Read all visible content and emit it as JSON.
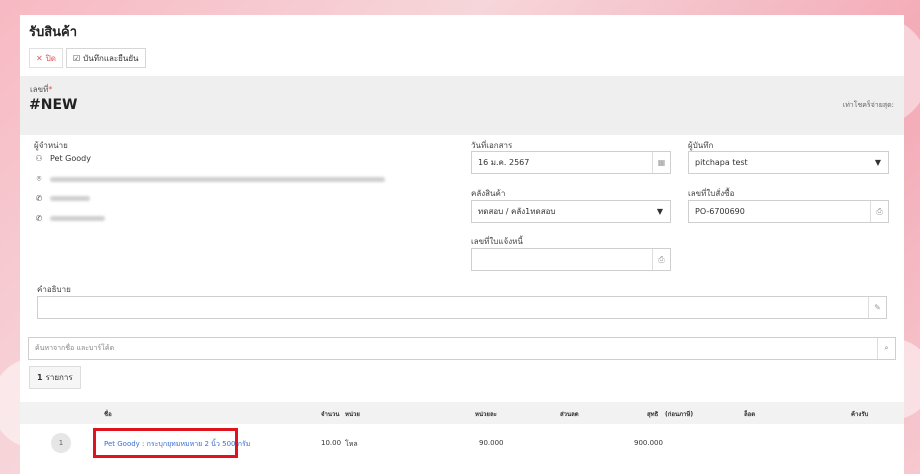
{
  "page": {
    "title": "รับสินค้า",
    "toolbar": {
      "close_label": "ปิด",
      "save_confirm_label": "บันทึกและยืนยัน"
    },
    "doc": {
      "label": "เลขที่",
      "required_mark": "*",
      "number": "#NEW",
      "vat_note": "เท่าโชคร็จ่ายสุด:"
    }
  },
  "supplier": {
    "label": "ผู้จำหน่าย",
    "name": "Pet Goody"
  },
  "form": {
    "doc_date": {
      "label": "วันที่เอกสาร",
      "value": "16 ม.ค. 2567"
    },
    "recorder": {
      "label": "ผู้บันทึก",
      "value": "pitchapa test"
    },
    "warehouse": {
      "label": "คลังสินค้า",
      "value": "ทดสอบ / คลัง1ทดสอบ"
    },
    "po_number": {
      "label": "เลขที่ใบสั่งซื้อ",
      "value": "PO-6700690"
    },
    "invoice_number": {
      "label": "เลขที่ใบแจ้งหนี้",
      "value": ""
    },
    "description": {
      "label": "คำอธิบาย",
      "value": ""
    }
  },
  "search": {
    "placeholder": "ค้นหาจากชื่อ และบาร์โค้ด"
  },
  "items_count": {
    "number": "1",
    "unit": "รายการ"
  },
  "table": {
    "headers": {
      "name": "ชื่อ",
      "qty": "จำนวน",
      "unit": "หน่วย",
      "unit_price": "หน่วยละ",
      "discount": "ส่วนลด",
      "net": "สุทธิ",
      "net_after": "(ก่อนภาษี)",
      "lot": "ล็อต",
      "due": "ค้างรับ"
    },
    "rows": [
      {
        "index": "1",
        "name": "Pet Goody : กระบุกยุทมหมหาย 2 นิ้ว 500 กรัม",
        "qty": "10.00",
        "unit": "โหล",
        "unit_price": "90.000",
        "net": "900.000"
      }
    ]
  },
  "colors": {
    "close": "#e05555",
    "link": "#3b6fd1",
    "highlight": "#e0141e"
  },
  "icons": [
    "close-icon",
    "checkbox-icon",
    "user-icon",
    "map-pin-icon",
    "phone-icon",
    "calendar-icon",
    "chevron-down-icon",
    "edit-icon",
    "search-icon"
  ]
}
